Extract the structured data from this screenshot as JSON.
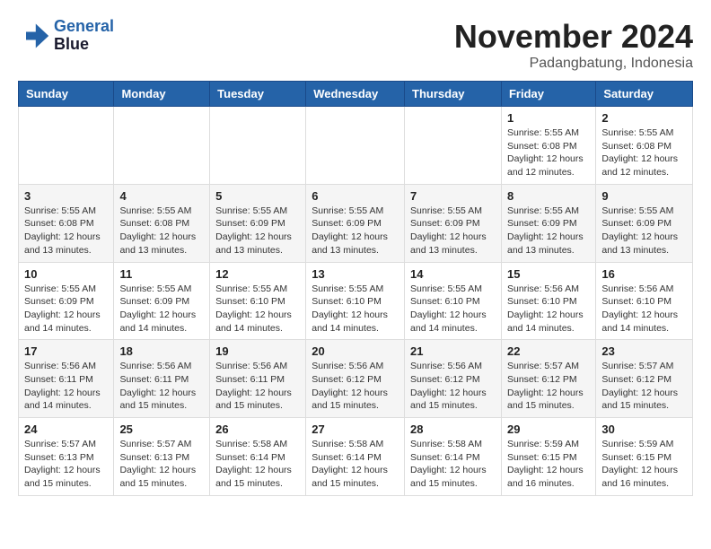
{
  "logo": {
    "line1": "General",
    "line2": "Blue"
  },
  "title": "November 2024",
  "subtitle": "Padangbatung, Indonesia",
  "weekdays": [
    "Sunday",
    "Monday",
    "Tuesday",
    "Wednesday",
    "Thursday",
    "Friday",
    "Saturday"
  ],
  "weeks": [
    [
      {
        "day": "",
        "info": ""
      },
      {
        "day": "",
        "info": ""
      },
      {
        "day": "",
        "info": ""
      },
      {
        "day": "",
        "info": ""
      },
      {
        "day": "",
        "info": ""
      },
      {
        "day": "1",
        "info": "Sunrise: 5:55 AM\nSunset: 6:08 PM\nDaylight: 12 hours and 12 minutes."
      },
      {
        "day": "2",
        "info": "Sunrise: 5:55 AM\nSunset: 6:08 PM\nDaylight: 12 hours and 12 minutes."
      }
    ],
    [
      {
        "day": "3",
        "info": "Sunrise: 5:55 AM\nSunset: 6:08 PM\nDaylight: 12 hours and 13 minutes."
      },
      {
        "day": "4",
        "info": "Sunrise: 5:55 AM\nSunset: 6:08 PM\nDaylight: 12 hours and 13 minutes."
      },
      {
        "day": "5",
        "info": "Sunrise: 5:55 AM\nSunset: 6:09 PM\nDaylight: 12 hours and 13 minutes."
      },
      {
        "day": "6",
        "info": "Sunrise: 5:55 AM\nSunset: 6:09 PM\nDaylight: 12 hours and 13 minutes."
      },
      {
        "day": "7",
        "info": "Sunrise: 5:55 AM\nSunset: 6:09 PM\nDaylight: 12 hours and 13 minutes."
      },
      {
        "day": "8",
        "info": "Sunrise: 5:55 AM\nSunset: 6:09 PM\nDaylight: 12 hours and 13 minutes."
      },
      {
        "day": "9",
        "info": "Sunrise: 5:55 AM\nSunset: 6:09 PM\nDaylight: 12 hours and 13 minutes."
      }
    ],
    [
      {
        "day": "10",
        "info": "Sunrise: 5:55 AM\nSunset: 6:09 PM\nDaylight: 12 hours and 14 minutes."
      },
      {
        "day": "11",
        "info": "Sunrise: 5:55 AM\nSunset: 6:09 PM\nDaylight: 12 hours and 14 minutes."
      },
      {
        "day": "12",
        "info": "Sunrise: 5:55 AM\nSunset: 6:10 PM\nDaylight: 12 hours and 14 minutes."
      },
      {
        "day": "13",
        "info": "Sunrise: 5:55 AM\nSunset: 6:10 PM\nDaylight: 12 hours and 14 minutes."
      },
      {
        "day": "14",
        "info": "Sunrise: 5:55 AM\nSunset: 6:10 PM\nDaylight: 12 hours and 14 minutes."
      },
      {
        "day": "15",
        "info": "Sunrise: 5:56 AM\nSunset: 6:10 PM\nDaylight: 12 hours and 14 minutes."
      },
      {
        "day": "16",
        "info": "Sunrise: 5:56 AM\nSunset: 6:10 PM\nDaylight: 12 hours and 14 minutes."
      }
    ],
    [
      {
        "day": "17",
        "info": "Sunrise: 5:56 AM\nSunset: 6:11 PM\nDaylight: 12 hours and 14 minutes."
      },
      {
        "day": "18",
        "info": "Sunrise: 5:56 AM\nSunset: 6:11 PM\nDaylight: 12 hours and 15 minutes."
      },
      {
        "day": "19",
        "info": "Sunrise: 5:56 AM\nSunset: 6:11 PM\nDaylight: 12 hours and 15 minutes."
      },
      {
        "day": "20",
        "info": "Sunrise: 5:56 AM\nSunset: 6:12 PM\nDaylight: 12 hours and 15 minutes."
      },
      {
        "day": "21",
        "info": "Sunrise: 5:56 AM\nSunset: 6:12 PM\nDaylight: 12 hours and 15 minutes."
      },
      {
        "day": "22",
        "info": "Sunrise: 5:57 AM\nSunset: 6:12 PM\nDaylight: 12 hours and 15 minutes."
      },
      {
        "day": "23",
        "info": "Sunrise: 5:57 AM\nSunset: 6:12 PM\nDaylight: 12 hours and 15 minutes."
      }
    ],
    [
      {
        "day": "24",
        "info": "Sunrise: 5:57 AM\nSunset: 6:13 PM\nDaylight: 12 hours and 15 minutes."
      },
      {
        "day": "25",
        "info": "Sunrise: 5:57 AM\nSunset: 6:13 PM\nDaylight: 12 hours and 15 minutes."
      },
      {
        "day": "26",
        "info": "Sunrise: 5:58 AM\nSunset: 6:14 PM\nDaylight: 12 hours and 15 minutes."
      },
      {
        "day": "27",
        "info": "Sunrise: 5:58 AM\nSunset: 6:14 PM\nDaylight: 12 hours and 15 minutes."
      },
      {
        "day": "28",
        "info": "Sunrise: 5:58 AM\nSunset: 6:14 PM\nDaylight: 12 hours and 15 minutes."
      },
      {
        "day": "29",
        "info": "Sunrise: 5:59 AM\nSunset: 6:15 PM\nDaylight: 12 hours and 16 minutes."
      },
      {
        "day": "30",
        "info": "Sunrise: 5:59 AM\nSunset: 6:15 PM\nDaylight: 12 hours and 16 minutes."
      }
    ]
  ]
}
